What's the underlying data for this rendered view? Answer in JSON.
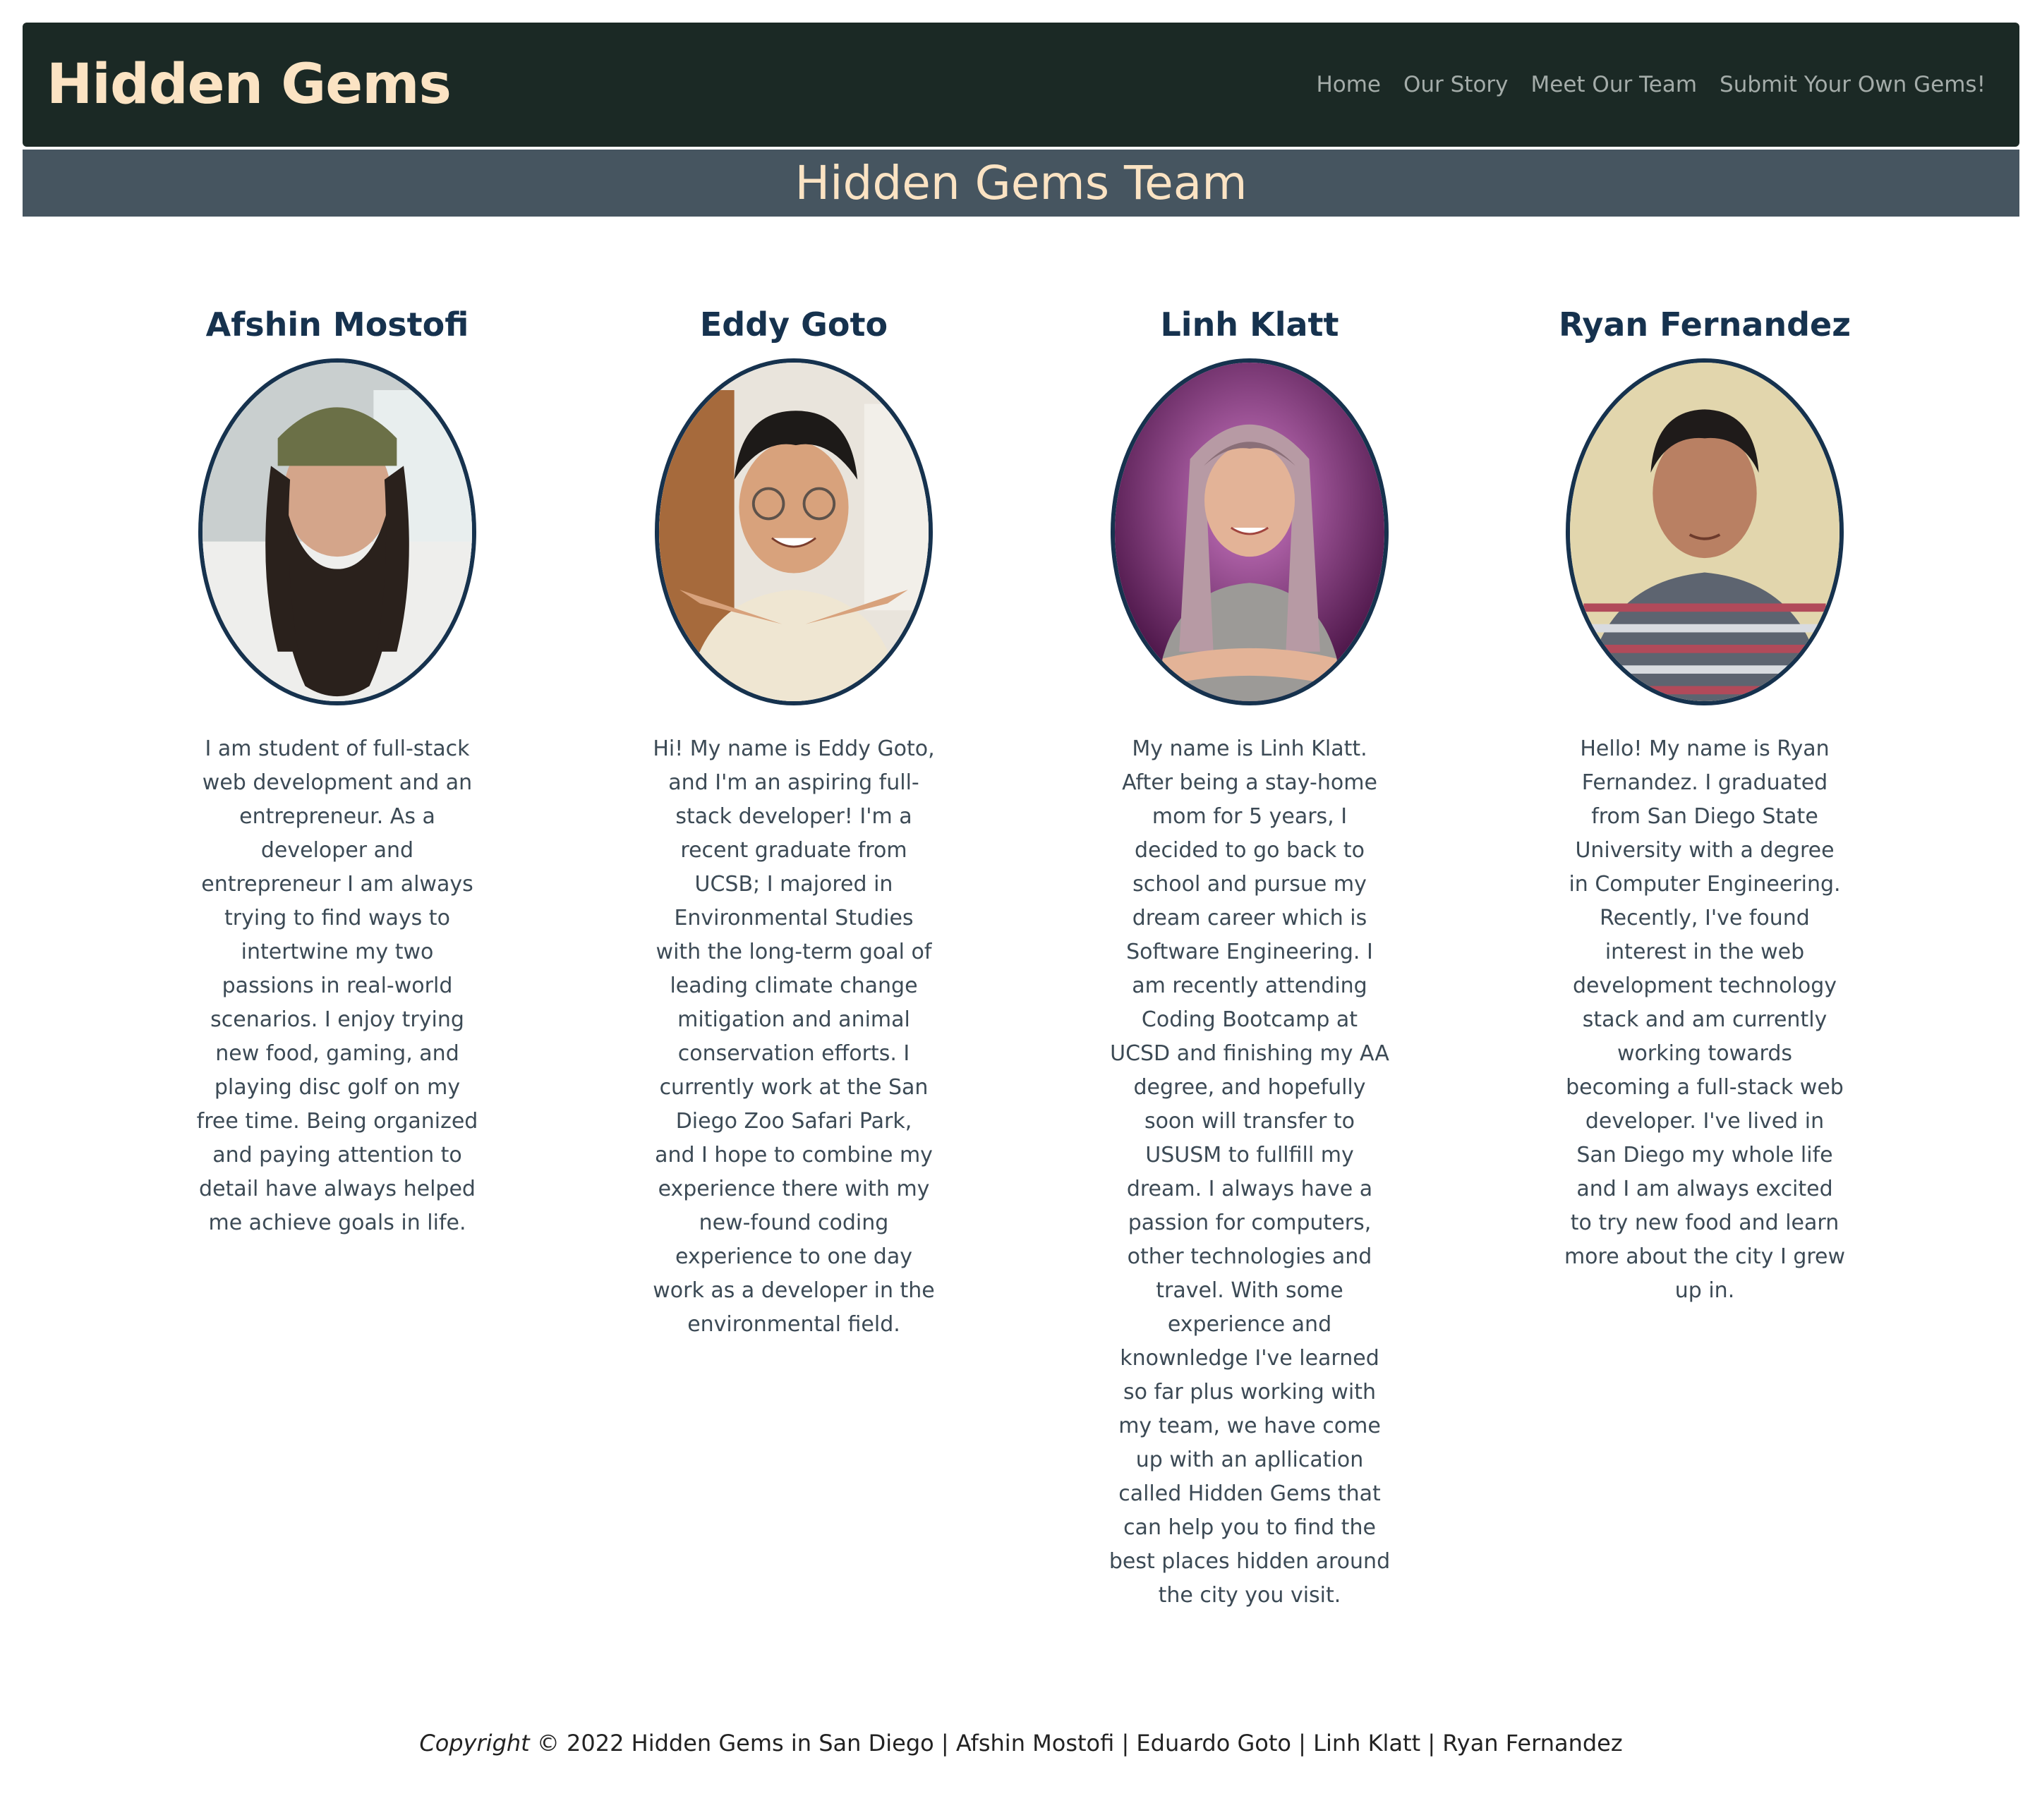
{
  "header": {
    "brand": "Hidden Gems",
    "nav": [
      {
        "label": "Home"
      },
      {
        "label": "Our Story"
      },
      {
        "label": "Meet Our Team"
      },
      {
        "label": "Submit Your Own Gems!"
      }
    ]
  },
  "banner": {
    "title": "Hidden Gems Team"
  },
  "team": [
    {
      "name": "Afshin Mostofi",
      "bio": "I am student of full-stack web development and an entrepreneur. As a developer and entrepreneur I am always trying to find ways to intertwine my two passions in real-world scenarios. I enjoy trying new food, gaming, and playing disc golf on my free time. Being organized and paying attention to detail have always helped me achieve goals in life."
    },
    {
      "name": "Eddy Goto",
      "bio": "Hi! My name is Eddy Goto, and I'm an aspiring full-stack developer! I'm a recent graduate from UCSB; I majored in Environmental Studies with the long-term goal of leading climate change mitigation and animal conservation efforts. I currently work at the San Diego Zoo Safari Park, and I hope to combine my experience there with my new-found coding experience to one day work as a developer in the environmental field."
    },
    {
      "name": "Linh Klatt",
      "bio": "My name is Linh Klatt. After being a stay-home mom for 5 years, I decided to go back to school and pursue my dream career which is Software Engineering. I am recently attending Coding Bootcamp at UCSD and finishing my AA degree, and hopefully soon will transfer to USUSM to fullfill my dream. I always have a passion for computers, other technologies and travel. With some experience and knownledge I've learned so far plus working with my team, we have come up with an apllication called Hidden Gems that can help you to find the best places hidden around the city you visit."
    },
    {
      "name": "Ryan Fernandez",
      "bio": "Hello! My name is Ryan Fernandez. I graduated from San Diego State University with a degree in Computer Engineering. Recently, I've found interest in the web development technology stack and am currently working towards becoming a full-stack web developer. I've lived in San Diego my whole life and I am always excited to try new food and learn more about the city I grew up in."
    }
  ],
  "footer": {
    "copyright_word": "Copyright",
    "text": "© 2022 Hidden Gems in San Diego | Afshin Mostofi | Eduardo Goto | Linh Klatt | Ryan Fernandez"
  }
}
